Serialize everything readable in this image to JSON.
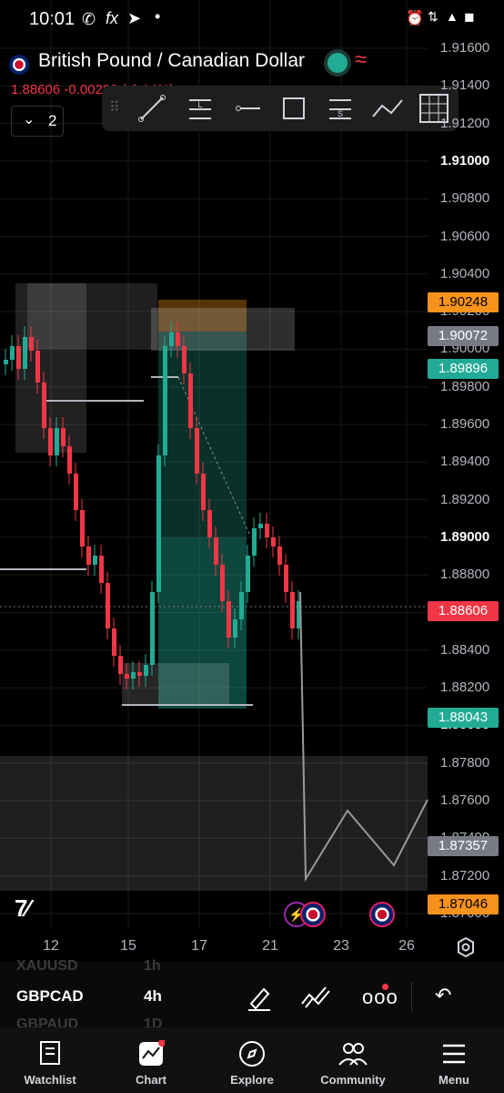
{
  "status": {
    "time": "10:01",
    "battery": "◼",
    "signal": "▲"
  },
  "header": {
    "pair_title": "British Pound / Canadian Dollar",
    "price_line": "1.88606  -0.00283 (-0.14%)",
    "layer_count": "2"
  },
  "toolbar": {
    "tools": [
      "trend-line-icon",
      "long-position-icon",
      "horizontal-ray-icon",
      "rectangle-icon",
      "short-position-icon",
      "path-icon",
      "fib-grid-icon"
    ]
  },
  "price_axis": {
    "labels": [
      "1.91600",
      "1.91400",
      "1.91200",
      "1.91000",
      "1.90800",
      "1.90600",
      "1.90400",
      "1.90200",
      "1.90000",
      "1.89800",
      "1.89600",
      "1.89400",
      "1.89200",
      "1.89000",
      "1.88800",
      "1.88600",
      "1.88400",
      "1.88200",
      "1.88000",
      "1.87800",
      "1.87600",
      "1.87400",
      "1.87200",
      "1.87000"
    ],
    "tags": [
      {
        "label": "1.90248",
        "bg": "#f7931a",
        "fg": "#000"
      },
      {
        "label": "1.90072",
        "bg": "#787b86",
        "fg": "#fff"
      },
      {
        "label": "1.89896",
        "bg": "#22ab94",
        "fg": "#fff"
      },
      {
        "label": "1.88606",
        "bg": "#f23645",
        "fg": "#fff"
      },
      {
        "label": "1.88043",
        "bg": "#22ab94",
        "fg": "#fff"
      },
      {
        "label": "1.87357",
        "bg": "#787b86",
        "fg": "#fff"
      },
      {
        "label": "1.87046",
        "bg": "#f7931a",
        "fg": "#000"
      }
    ]
  },
  "time_axis": {
    "labels": [
      "12",
      "15",
      "17",
      "21",
      "23",
      "26"
    ]
  },
  "watchlist_peek": {
    "rows": [
      {
        "symbol": "XAUUSD",
        "interval": "1h"
      },
      {
        "symbol": "GBPCAD",
        "interval": "4h"
      },
      {
        "symbol": "GBPAUD",
        "interval": "1D"
      }
    ]
  },
  "bottom_nav": {
    "items": [
      {
        "label": "Watchlist",
        "icon": "watchlist-icon"
      },
      {
        "label": "Chart",
        "icon": "chart-icon"
      },
      {
        "label": "Explore",
        "icon": "compass-icon"
      },
      {
        "label": "Community",
        "icon": "people-icon"
      },
      {
        "label": "Menu",
        "icon": "hamburger-icon"
      }
    ]
  },
  "colors": {
    "up": "#22ab94",
    "down": "#f23645",
    "accent": "#f7931a"
  }
}
